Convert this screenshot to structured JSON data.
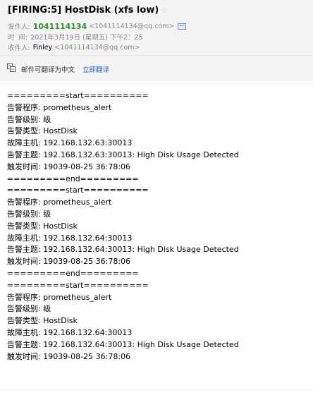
{
  "header": {
    "subject": "[FIRING:5] HostDisk (xfs low)",
    "from_label": "发件人:",
    "from_name": "1041114134",
    "from_addr": "<1041114134@qq.com>",
    "time_label": "时  间:",
    "time_value": "2021年3月19日 (星期五) 下午2：25",
    "to_label": "收件人:",
    "to_name": "Finley",
    "to_addr": "<1041114134@qq.com>"
  },
  "translate": {
    "text": "邮件可翻译为中文",
    "link": "立即翻译"
  },
  "body": {
    "lines": [
      "=========start==========",
      "告警程序: prometheus_alert",
      "告警级别: 级",
      "告警类型: HostDisk",
      "故障主机: 192.168.132.63:30013",
      "告警主题: 192.168.132.63:30013: High Disk Usage Detected",
      "触发时间: 19039-08-25 36:78:06",
      "=========end=========",
      "=========start==========",
      "告警程序: prometheus_alert",
      "告警级别: 级",
      "告警类型: HostDisk",
      "故障主机: 192.168.132.64:30013",
      "告警主题: 192.168.132.64:30013: High Disk Usage Detected",
      "触发时间: 19039-08-25 36:78:06",
      "=========end=========",
      "=========start==========",
      "告警程序: prometheus_alert",
      "告警级别: 级",
      "告警类型: HostDisk",
      "故障主机: 192.168.132.64:30013",
      "告警主题: 192.168.132.64:30013: High Disk Usage Detected",
      "触发时间: 19039-08-25 36:78:06"
    ]
  }
}
